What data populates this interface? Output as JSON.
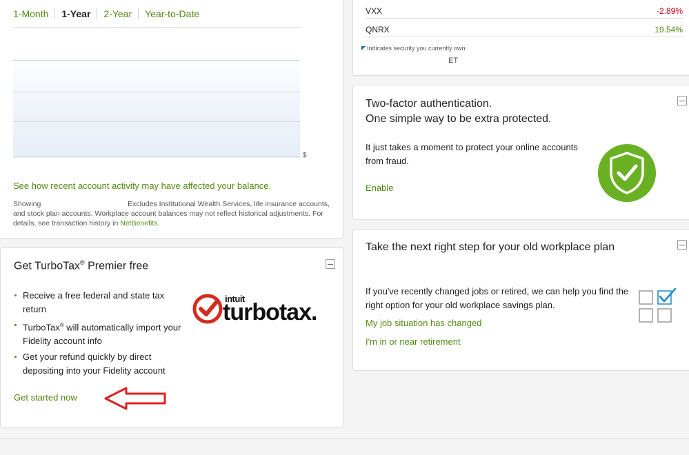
{
  "balance": {
    "tabs": [
      {
        "label": "1-Month",
        "active": false
      },
      {
        "label": "1-Year",
        "active": true
      },
      {
        "label": "2-Year",
        "active": false
      },
      {
        "label": "Year-to-Date",
        "active": false
      }
    ],
    "axis_symbol": "$",
    "activity_link": "See how recent account activity may have affected your balance.",
    "disclaimer_prefix": "Showing",
    "disclaimer_main": "Excludes Institutional Wealth Services, life insurance accounts, and stock plan accounts. Workplace account balances may not reflect historical adjustments. For details, see transaction history in",
    "disclaimer_link": "NetBenefits",
    "disclaimer_end": "."
  },
  "turbotax": {
    "title": "Get TurboTax",
    "title_mark": "®",
    "title_rest": " Premier free",
    "bullets": [
      {
        "text": "Receive a free federal and state tax return"
      },
      {
        "text_a": "TurboTax",
        "mark": "®",
        "text_b": " will automatically import your Fidelity account info"
      },
      {
        "text": "Get your refund quickly by direct depositing into your Fidelity account"
      }
    ],
    "cta": "Get started now",
    "logo_top": "intuit",
    "logo_word": "turbotax."
  },
  "watchlist": {
    "rows": [
      {
        "symbol": "VXX",
        "change": "-2.89%"
      },
      {
        "symbol": "QNRX",
        "change": "19.54%"
      }
    ],
    "note": "Indicates security you currently own",
    "time_suffix": "ET"
  },
  "two_factor": {
    "title_line1": "Two-factor authentication.",
    "title_line2": "One simple way to be extra protected.",
    "description": "It just takes a moment to protect your online accounts from fraud.",
    "cta": "Enable"
  },
  "old_workplace": {
    "title": "Take the next right step for your old workplace plan",
    "description": "If you've recently changed jobs or retired, we can help you find the right option for your old workplace savings plan.",
    "link1": "My job situation has changed",
    "link2": "I'm in or near retirement"
  },
  "colors": {
    "link_green": "#4f8a10",
    "negative_red": "#d0021b",
    "shield_green": "#6ab023",
    "checkbox_blue": "#1a8cc8"
  }
}
